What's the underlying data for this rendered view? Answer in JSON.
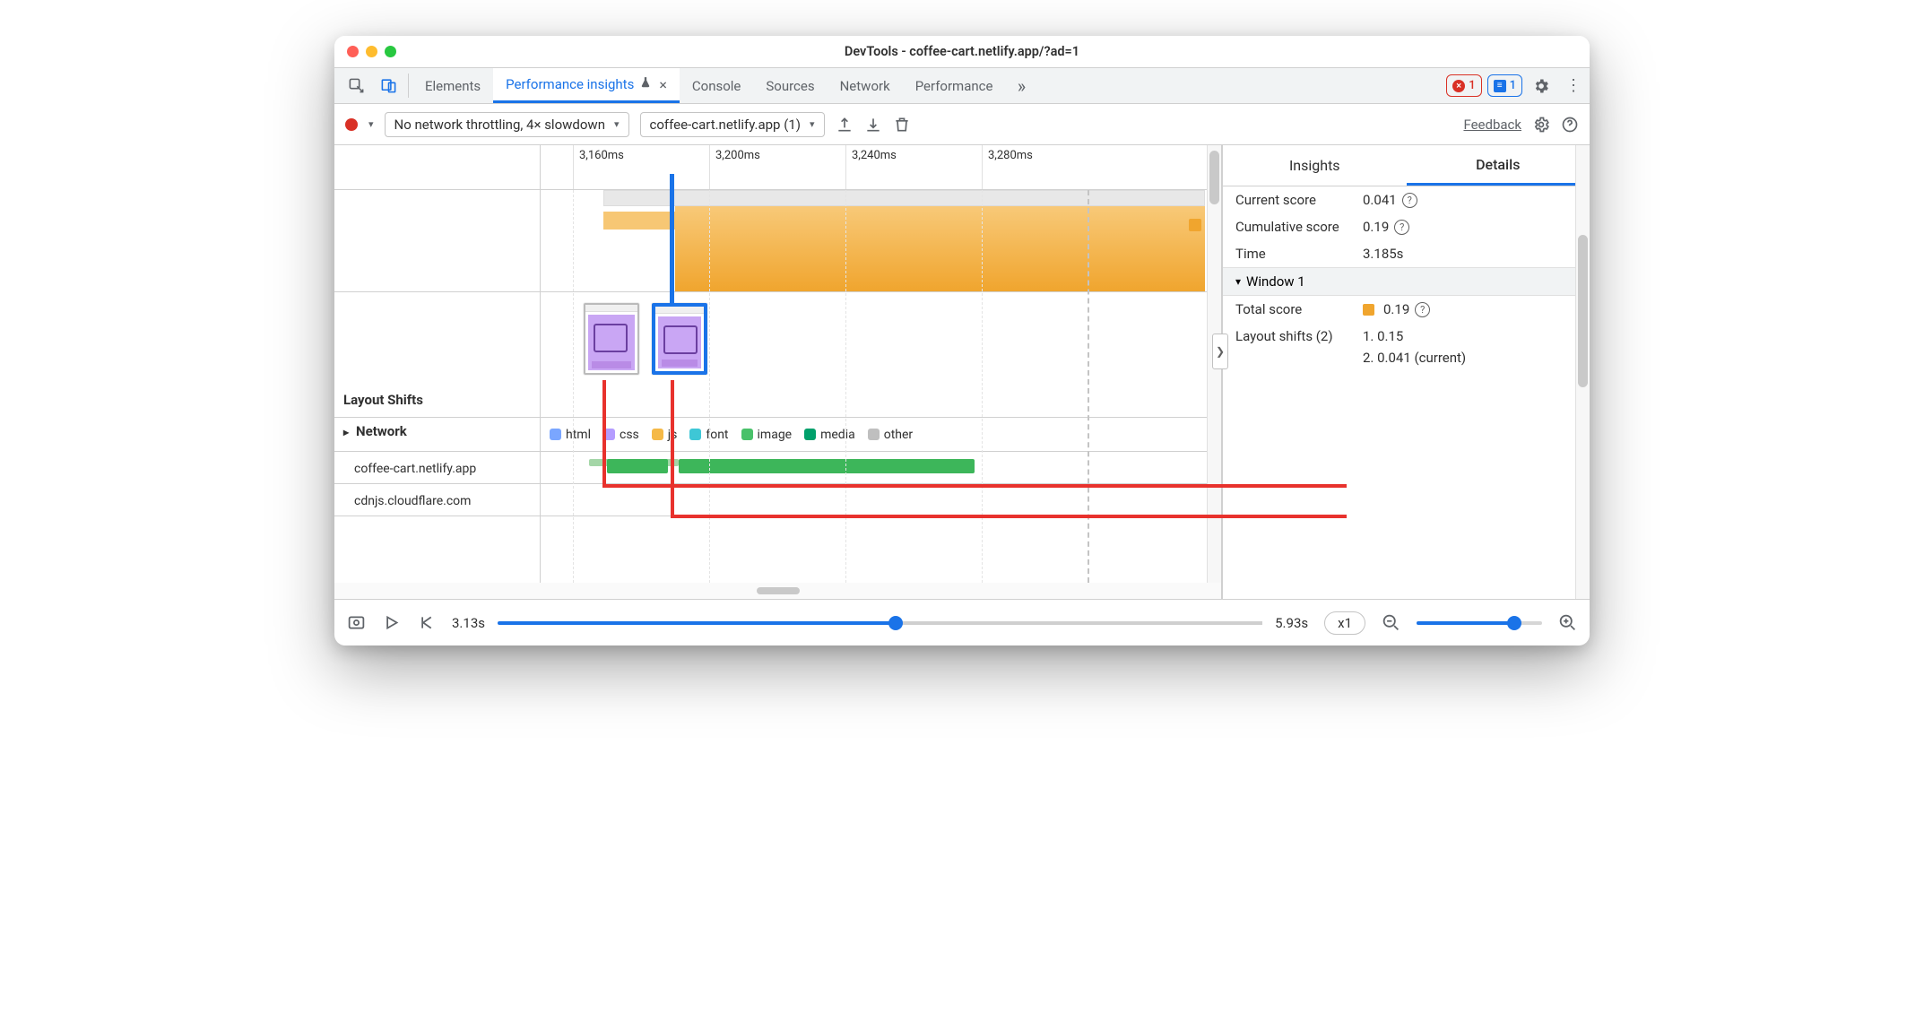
{
  "window": {
    "title": "DevTools - coffee-cart.netlify.app/?ad=1"
  },
  "tabs": {
    "items": [
      "Elements",
      "Performance insights",
      "Console",
      "Sources",
      "Network",
      "Performance"
    ],
    "activeIndex": 1
  },
  "badges": {
    "errors": "1",
    "issues": "1"
  },
  "toolbar": {
    "throttling": "No network throttling, 4× slowdown",
    "page": "coffee-cart.netlify.app (1)",
    "feedback": "Feedback"
  },
  "ruler": {
    "ticks": [
      "3,160ms",
      "3,200ms",
      "3,240ms",
      "3,280ms"
    ]
  },
  "tracks": {
    "layoutShiftsLabel": "Layout Shifts",
    "networkLabel": "Network",
    "hosts": [
      "coffee-cart.netlify.app",
      "cdnjs.cloudflare.com"
    ]
  },
  "legend": [
    {
      "label": "html",
      "color": "#7aa6ff"
    },
    {
      "label": "css",
      "color": "#b49cff"
    },
    {
      "label": "js",
      "color": "#f5b947"
    },
    {
      "label": "font",
      "color": "#3ec7d6"
    },
    {
      "label": "image",
      "color": "#49c16a"
    },
    {
      "label": "media",
      "color": "#00a06b"
    },
    {
      "label": "other",
      "color": "#bfbfbf"
    }
  ],
  "sidebar": {
    "tabs": {
      "insights": "Insights",
      "details": "Details",
      "active": "details"
    },
    "currentScore": {
      "label": "Current score",
      "value": "0.041"
    },
    "cumulativeScore": {
      "label": "Cumulative score",
      "value": "0.19"
    },
    "time": {
      "label": "Time",
      "value": "3.185s"
    },
    "window": {
      "title": "Window 1",
      "totalScore": {
        "label": "Total score",
        "value": "0.19"
      },
      "layoutShifts": {
        "label": "Layout shifts (2)",
        "items": [
          "1. 0.15",
          "2. 0.041 (current)"
        ]
      }
    }
  },
  "transport": {
    "start": "3.13s",
    "end": "5.93s",
    "speed": "x1"
  }
}
